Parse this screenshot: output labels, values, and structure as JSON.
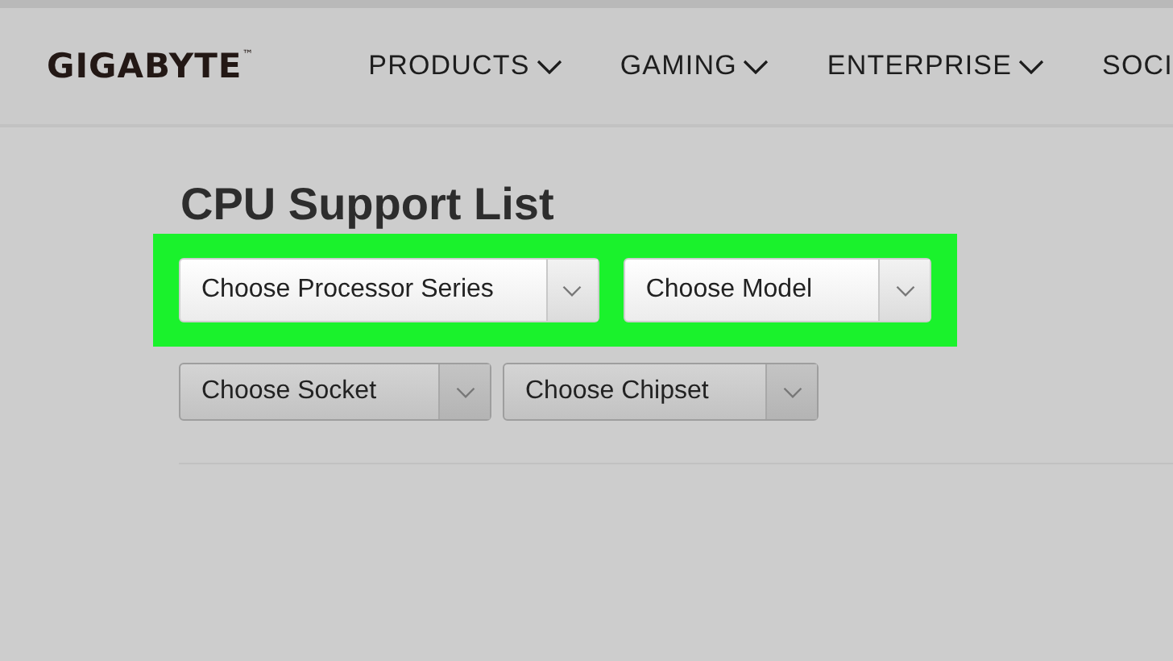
{
  "header": {
    "logo": "GIGABYTE$^{™}$",
    "nav": [
      {
        "label": "PRODUCTS",
        "has_menu": true
      },
      {
        "label": "GAMING",
        "has_menu": true
      },
      {
        "label": "ENTERPRISE",
        "has_menu": true
      },
      {
        "label": "SOCI",
        "has_menu": false
      }
    ]
  },
  "page_title": "CPU Support List",
  "filter_rows": [
    {
      "highlighted": true,
      "dropdowns": [
        {
          "placeholder": "Choose Processor Series"
        },
        {
          "placeholder": "Choose Model"
        }
      ]
    },
    {
      "highlighted": false,
      "dropdowns": [
        {
          "placeholder": "Choose Socket"
        },
        {
          "placeholder": "Choose Chipset"
        }
      ]
    }
  ]
}
